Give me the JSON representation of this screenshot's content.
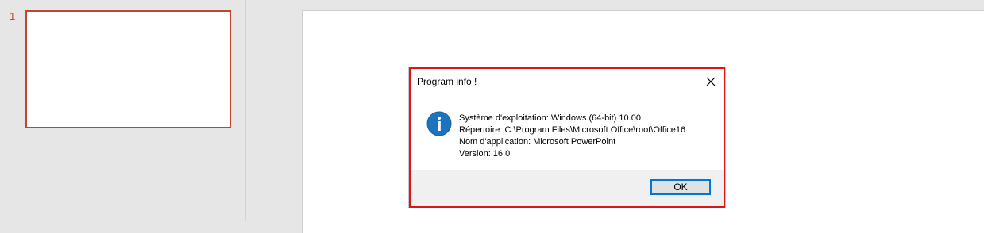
{
  "thumbnails": {
    "slides": [
      {
        "number": "1"
      }
    ]
  },
  "dialog": {
    "title": "Program info !",
    "icon": "info-icon",
    "lines": [
      "Système d'exploitation: Windows (64-bit) 10.00",
      "Répertoire: C:\\Program Files\\Microsoft Office\\root\\Office16",
      "Nom d'application: Microsoft PowerPoint",
      "Version: 16.0"
    ],
    "ok_label": "OK",
    "close_icon": "close-icon"
  },
  "colors": {
    "accent": "#c4462a",
    "dialog_highlight": "#e01414",
    "info_icon": "#1e73be",
    "button_focus": "#0078d7"
  }
}
